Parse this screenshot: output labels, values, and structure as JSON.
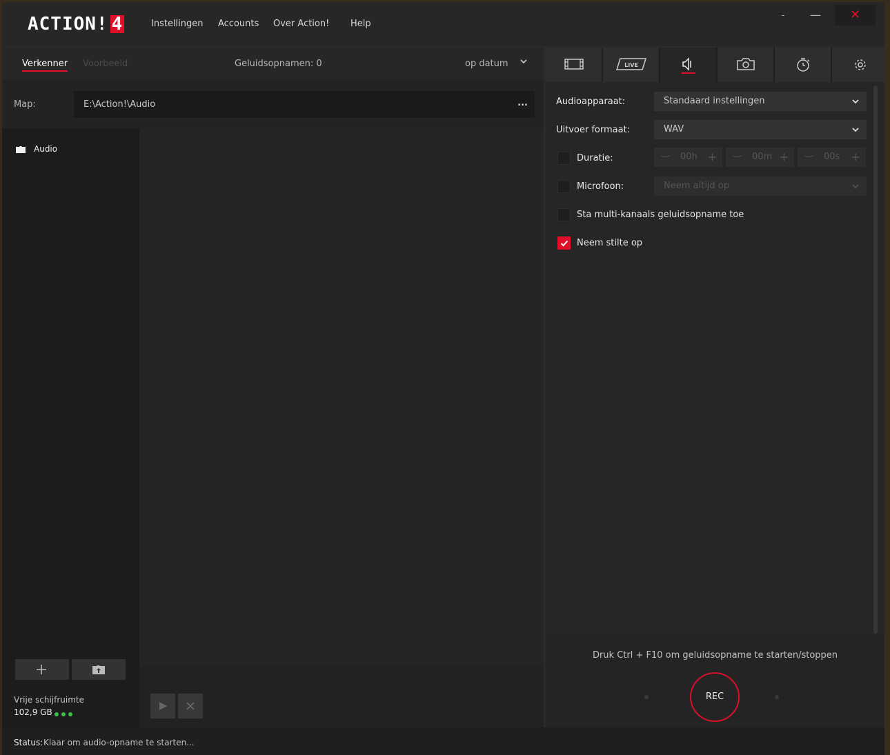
{
  "app": {
    "logo_text": "ACTION!",
    "logo_version": "4"
  },
  "menu": [
    "Instellingen",
    "Accounts",
    "Over Action!",
    "Help"
  ],
  "window_controls": {
    "minimize_small": "-",
    "minimize": "—",
    "close": "✕"
  },
  "left": {
    "tabs": {
      "explorer": "Verkenner",
      "preview": "Voorbeeld"
    },
    "recordings_count": "Geluidsopnamen: 0",
    "sort": "op datum",
    "map_label": "Map:",
    "map_path": "E:\\Action!\\Audio",
    "map_more": "...",
    "tree_items": [
      "Audio"
    ],
    "free_space_label": "Vrije schijfruimte",
    "free_space_value": "102,9 GB"
  },
  "right": {
    "tabs": [
      "video-tab",
      "live-tab",
      "audio-tab",
      "screenshot-tab",
      "timer-tab",
      "settings-tab"
    ],
    "audio_device_label": "Audioapparaat:",
    "audio_device_value": "Standaard instellingen",
    "output_format_label": "Uitvoer formaat:",
    "output_format_value": "WAV",
    "duration_label": "Duratie:",
    "duration": {
      "hours": "00h",
      "minutes": "00m",
      "seconds": "00s"
    },
    "microphone_label": "Microfoon:",
    "microphone_value": "Neem altijd op",
    "multichannel_label": "Sta multi-kanaals geluidsopname toe",
    "silence_label": "Neem stilte op",
    "silence_checked": true,
    "hint": "Druk Ctrl + F10 om geluidsopname te starten/stoppen",
    "rec_label": "REC"
  },
  "status": {
    "label": "Status:",
    "text": "Klaar om audio-opname te starten..."
  },
  "colors": {
    "accent": "#e0102a",
    "ok": "#3cc04a"
  }
}
